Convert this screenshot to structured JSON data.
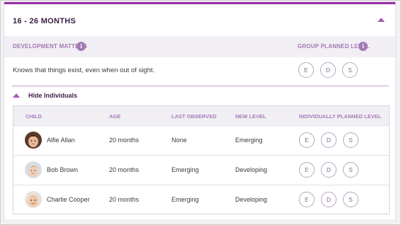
{
  "section": {
    "title": "16 - 26 MONTHS"
  },
  "development": {
    "label": "DEVELOPMENT MATTERS",
    "group_label": "GROUP PLANNED LEVEL",
    "statement": "Knows that things exist, even when out of sight.",
    "levels": [
      "E",
      "D",
      "S"
    ]
  },
  "toggle": {
    "label": "Hide Individuals"
  },
  "table": {
    "columns": [
      "CHILD",
      "AGE",
      "LAST OBSERVED",
      "NEW LEVEL",
      "INDIVIDUALLY PLANNED LEVEL"
    ],
    "rows": [
      {
        "name": "Alfie Allan",
        "age": "20 months",
        "last_observed": "None",
        "new_level": "Emerging"
      },
      {
        "name": "Bob Brown",
        "age": "20 months",
        "last_observed": "Emerging",
        "new_level": "Developing"
      },
      {
        "name": "Charlie Cooper",
        "age": "20 months",
        "last_observed": "Emerging",
        "new_level": "Developing"
      }
    ],
    "levels": [
      "E",
      "D",
      "S"
    ]
  },
  "icons": {
    "info": "info-icon",
    "collapse": "chevron-up-icon"
  },
  "colors": {
    "accent": "#9b2ea8",
    "header_text": "#3b1f45",
    "label_purple": "#a377b3"
  }
}
